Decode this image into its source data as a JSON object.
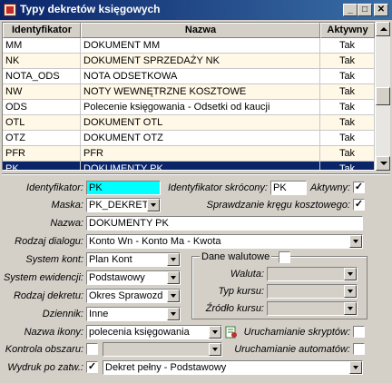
{
  "window": {
    "title": "Typy dekretów księgowych",
    "buttons": {
      "minimize": "_",
      "maximize": "□",
      "close": "✕"
    }
  },
  "table": {
    "columns": [
      "Identyfikator",
      "Nazwa",
      "Aktywny"
    ],
    "rows": [
      {
        "id": "MM",
        "name": "DOKUMENT MM",
        "active": "Tak"
      },
      {
        "id": "NK",
        "name": "DOKUMENT SPRZEDAŻY NK",
        "active": "Tak"
      },
      {
        "id": "NOTA_ODS",
        "name": "NOTA ODSETKOWA",
        "active": "Tak"
      },
      {
        "id": "NW",
        "name": "NOTY WEWNĘTRZNE KOSZTOWE",
        "active": "Tak"
      },
      {
        "id": "ODS",
        "name": "Polecenie księgowania - Odsetki od kaucji",
        "active": "Tak"
      },
      {
        "id": "OTL",
        "name": "DOKUMENT OTL",
        "active": "Tak"
      },
      {
        "id": "OTZ",
        "name": "DOKUMENT OTZ",
        "active": "Tak"
      },
      {
        "id": "PFR",
        "name": "PFR",
        "active": "Tak"
      },
      {
        "id": "PK",
        "name": "DOKUMENTY PK",
        "active": "Tak"
      }
    ],
    "selected_row": 8
  },
  "form": {
    "identyfikator": {
      "label": "Identyfikator:",
      "value": "PK"
    },
    "identyfikator_skrocony": {
      "label": "Identyfikator skrócony:",
      "value": "PK"
    },
    "aktywny": {
      "label": "Aktywny:",
      "checked": "✓"
    },
    "maska": {
      "label": "Maska:",
      "value": "PK_DEKRET"
    },
    "sprawdzanie": {
      "label": "Sprawdzanie kręgu kosztowego:",
      "checked": "✓"
    },
    "nazwa": {
      "label": "Nazwa:",
      "value": "DOKUMENTY PK"
    },
    "rodzaj_dialogu": {
      "label": "Rodzaj dialogu:",
      "value": "Konto Wn - Konto Ma - Kwota"
    },
    "system_kont": {
      "label": "System kont:",
      "value": "Plan Kont"
    },
    "system_ewidencji": {
      "label": "System ewidencji:",
      "value": "Podstawowy"
    },
    "rodzaj_dekretu": {
      "label": "Rodzaj dekretu:",
      "value": "Okres Sprawozd"
    },
    "dziennik": {
      "label": "Dziennik:",
      "value": "Inne"
    },
    "dane_walutowe": {
      "label": "Dane walutowe",
      "checked": "",
      "waluta": {
        "label": "Waluta:",
        "value": ""
      },
      "typ_kursu": {
        "label": "Typ kursu:",
        "value": ""
      },
      "zrodlo_kursu": {
        "label": "Źródło kursu:",
        "value": ""
      }
    },
    "nazwa_ikony": {
      "label": "Nazwa ikony:",
      "value": "polecenia księgowania"
    },
    "uruchamianie_skryptow": {
      "label": "Uruchamianie skryptów:",
      "checked": ""
    },
    "kontrola_obszaru": {
      "label": "Kontrola obszaru:",
      "checked": "",
      "value": ""
    },
    "uruchamianie_automatow": {
      "label": "Uruchamianie automatów:",
      "checked": ""
    },
    "wydruk": {
      "label": "Wydruk po zatw.:",
      "checked": "✓",
      "value": "Dekret pełny - Podstawowy"
    }
  },
  "colors": {
    "title_bar": "#0a246a",
    "selected_row": "#0a246a",
    "highlight_field": "#00ffff",
    "alt_row": "#fff8e6"
  }
}
